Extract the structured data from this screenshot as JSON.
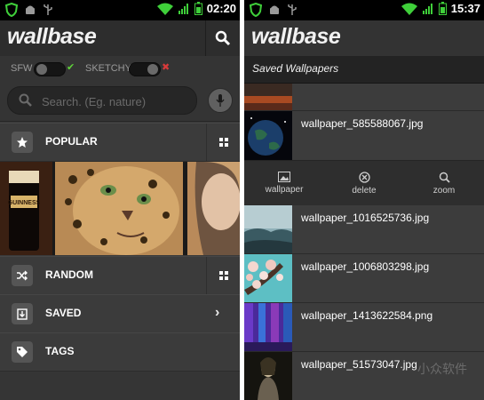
{
  "left": {
    "status": {
      "time": "02:20"
    },
    "app": {
      "logo": "wallbase"
    },
    "filters": {
      "sfw_label": "SFW",
      "sketchy_label": "SKETCHY",
      "sfw_mark": "✔",
      "sketchy_mark": "✖"
    },
    "search": {
      "placeholder": "Search. (Eg. nature)"
    },
    "nav": {
      "popular": {
        "label": "POPULAR",
        "icon": "star-icon"
      },
      "random": {
        "label": "RANDOM",
        "icon": "shuffle-icon"
      },
      "saved": {
        "label": "SAVED",
        "icon": "download-icon"
      },
      "tags": {
        "label": "TAGS",
        "icon": "tag-icon"
      }
    },
    "thumbnail_watermark": "GUINNESS"
  },
  "right": {
    "status": {
      "time": "15:37"
    },
    "app": {
      "logo": "wallbase"
    },
    "header": {
      "title": "Saved Wallpapers"
    },
    "files": [
      {
        "name": ""
      },
      {
        "name": "wallpaper_585588067.jpg"
      },
      {
        "name": "wallpaper_1016525736.jpg"
      },
      {
        "name": "wallpaper_1006803298.jpg"
      },
      {
        "name": "wallpaper_1413622584.png"
      },
      {
        "name": "wallpaper_51573047.jpg"
      }
    ],
    "actions": {
      "wallpaper": "wallpaper",
      "delete": "delete",
      "zoom": "zoom"
    }
  },
  "watermark": "小众软件",
  "colors": {
    "accent_green": "#5fd23a",
    "alert_red": "#d83a3a",
    "wifi_green": "#3fcf3a"
  }
}
